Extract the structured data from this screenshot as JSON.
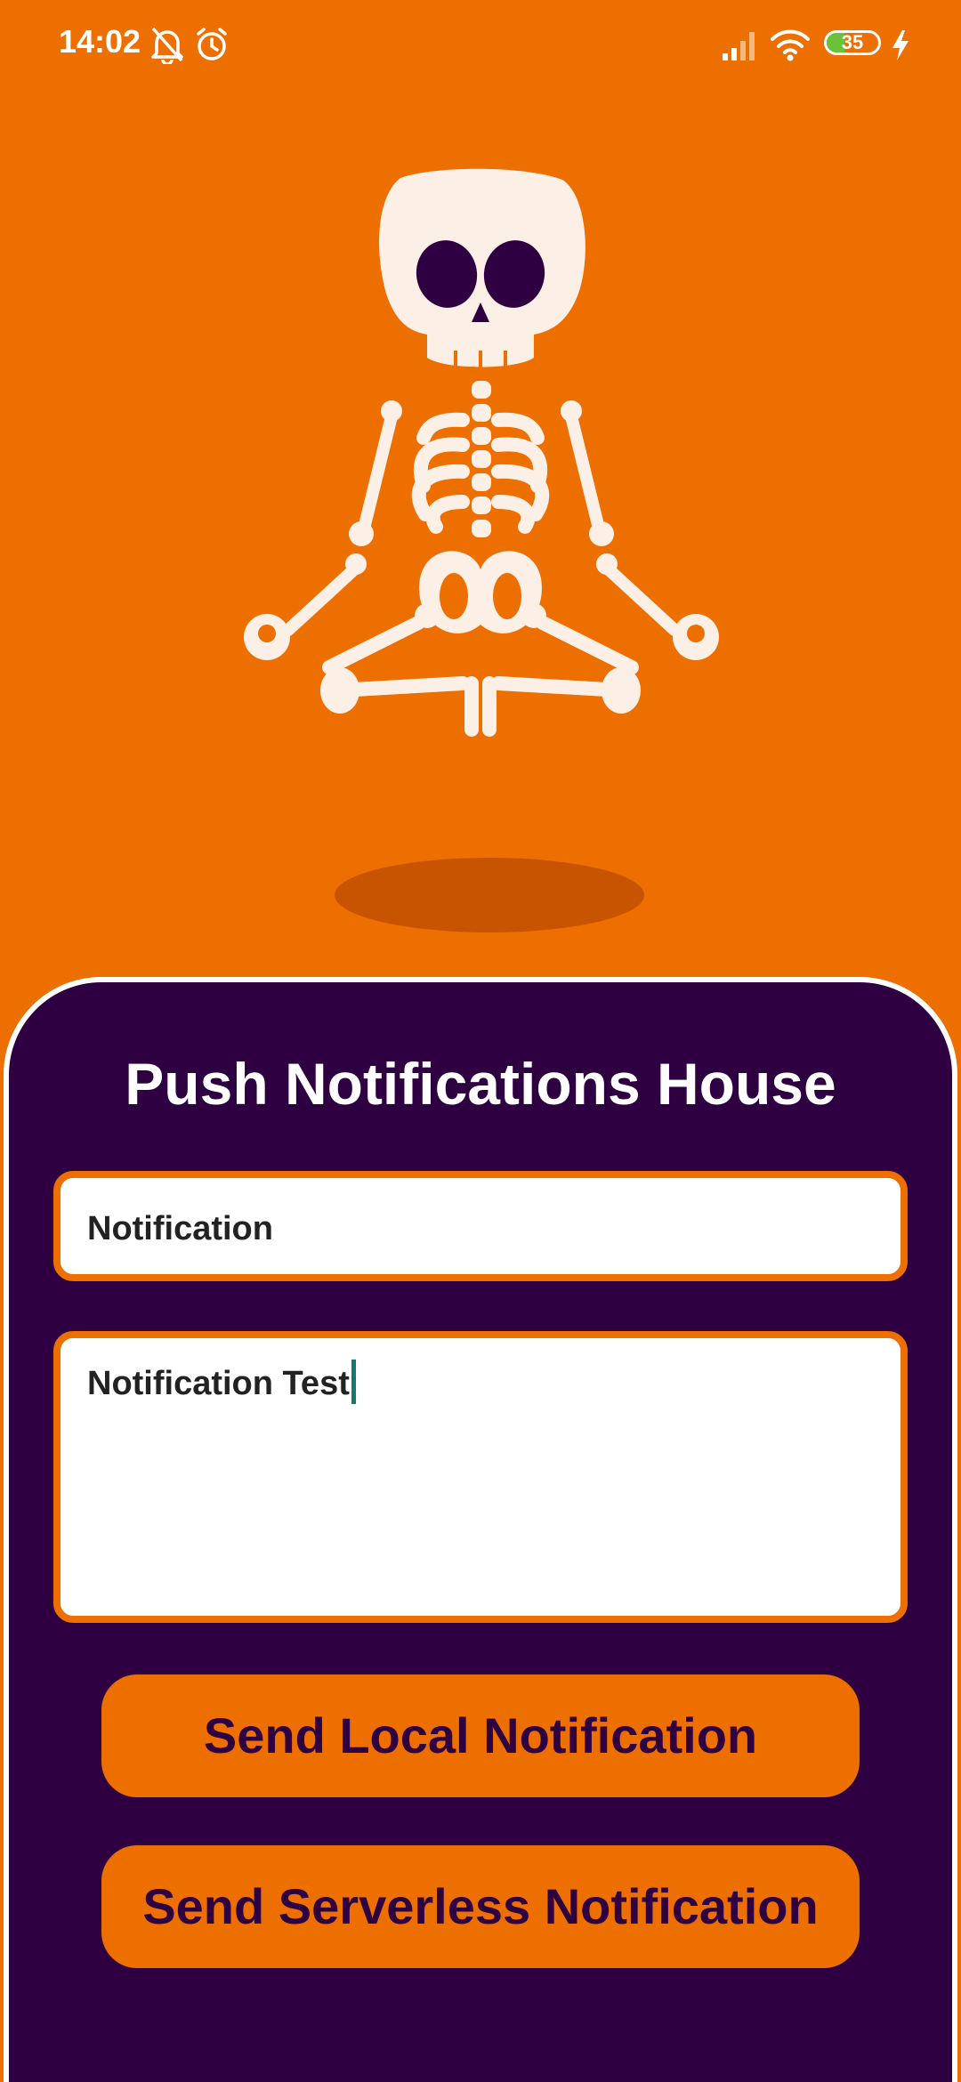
{
  "status_bar": {
    "time": "14:02",
    "battery_level": "35",
    "icons": [
      "bell-muted-icon",
      "alarm-icon",
      "signal-icon",
      "wifi-icon",
      "battery-icon",
      "charging-icon"
    ]
  },
  "illustration": {
    "name": "meditating-skeleton"
  },
  "panel": {
    "title": "Push Notifications House"
  },
  "form": {
    "title_value": "Notification",
    "body_value": "Notification Test"
  },
  "buttons": {
    "local_label": "Send Local Notification",
    "serverless_label": "Send Serverless Notification"
  },
  "colors": {
    "background": "#EC6F00",
    "panel": "#2E0041",
    "skull": "#FBEFE6",
    "shadow": "#C85300",
    "caret": "#0E7C6E"
  }
}
